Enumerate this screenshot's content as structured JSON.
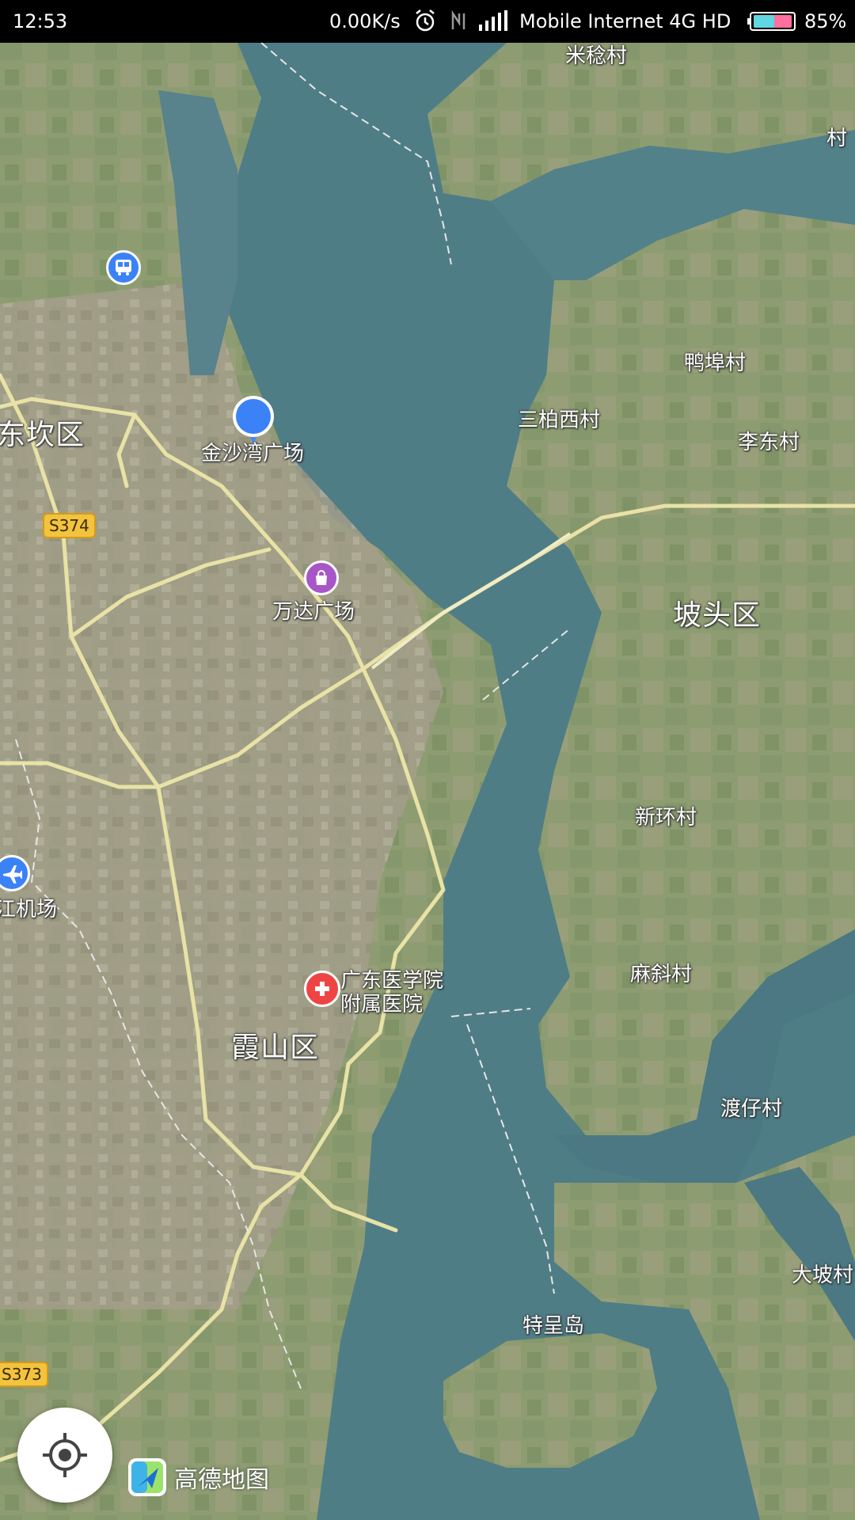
{
  "status_bar": {
    "time": "12:53",
    "speed": "0.00K/s",
    "network": "Mobile Internet 4G HD",
    "battery": "85%",
    "icons": [
      "alarm-icon",
      "nfc-icon",
      "signal-icon",
      "battery-icon"
    ]
  },
  "map": {
    "places": {
      "micong": "米稔村",
      "cun_edge": "村",
      "yabu": "鸭埠村",
      "sanbaixi": "三柏西村",
      "lidong": "李东村",
      "dongkan": "东坎区",
      "jinshawan": "金沙湾广场",
      "wanda": "万达广场",
      "potou": "坡头区",
      "xinhuan": "新环村",
      "airport": "江机场",
      "hospital_line1": "广东医学院",
      "hospital_line2": "附属医院",
      "maxie": "麻斜村",
      "xiashan": "霞山区",
      "duzai": "渡仔村",
      "dapo": "大坡村",
      "tehuang": "特呈岛"
    },
    "highways": {
      "s374": "S374",
      "s373": "S373"
    }
  },
  "branding": {
    "app_name": "高德地图"
  },
  "colors": {
    "water": "#4f7d86",
    "land": "#8e9c72",
    "road": "#e8e2a6",
    "location_dot": "#3b82f6",
    "highway_badge": "#f2c33f"
  }
}
